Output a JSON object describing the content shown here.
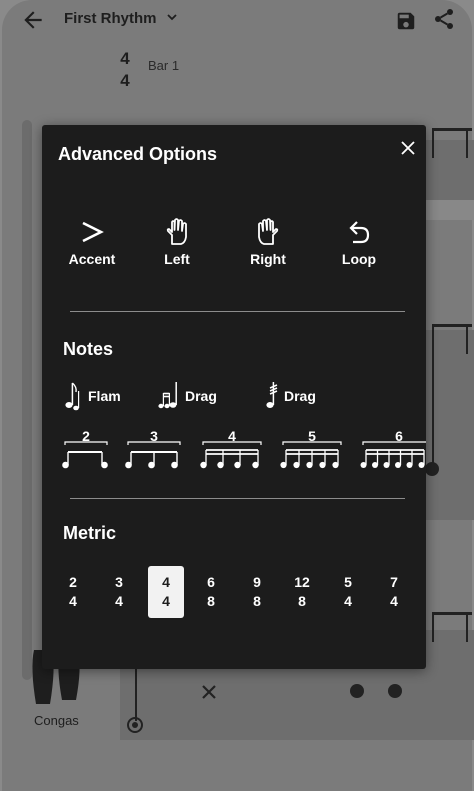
{
  "app": {
    "title": "First Rhythm",
    "bar_label": "Bar 1",
    "time_signature": {
      "top": "4",
      "bottom": "4"
    },
    "instrument_label": "Congas"
  },
  "modal": {
    "title": "Advanced Options",
    "options": [
      {
        "label": "Accent",
        "icon": "accent-icon"
      },
      {
        "label": "Left",
        "icon": "left-hand-icon"
      },
      {
        "label": "Right",
        "icon": "right-hand-icon"
      },
      {
        "label": "Loop",
        "icon": "loop-icon"
      }
    ],
    "notes_title": "Notes",
    "notes": [
      {
        "label": "Flam",
        "icon": "flam-icon"
      },
      {
        "label": "Drag",
        "icon": "drag-icon"
      },
      {
        "label": "Drag",
        "icon": "tremolo-drag-icon"
      }
    ],
    "tuplets": [
      "2",
      "3",
      "4",
      "5",
      "6"
    ],
    "metric_title": "Metric",
    "metrics": [
      {
        "top": "2",
        "bottom": "4",
        "selected": false
      },
      {
        "top": "3",
        "bottom": "4",
        "selected": false
      },
      {
        "top": "4",
        "bottom": "4",
        "selected": true
      },
      {
        "top": "6",
        "bottom": "8",
        "selected": false
      },
      {
        "top": "9",
        "bottom": "8",
        "selected": false
      },
      {
        "top": "12",
        "bottom": "8",
        "selected": false
      },
      {
        "top": "5",
        "bottom": "4",
        "selected": false
      },
      {
        "top": "7",
        "bottom": "4",
        "selected": false
      }
    ]
  },
  "colors": {
    "modal_bg": "#1c1c1c",
    "overlay": "#7b7b7b",
    "selected_bg": "#f2f2f2",
    "text": "#ffffff"
  }
}
